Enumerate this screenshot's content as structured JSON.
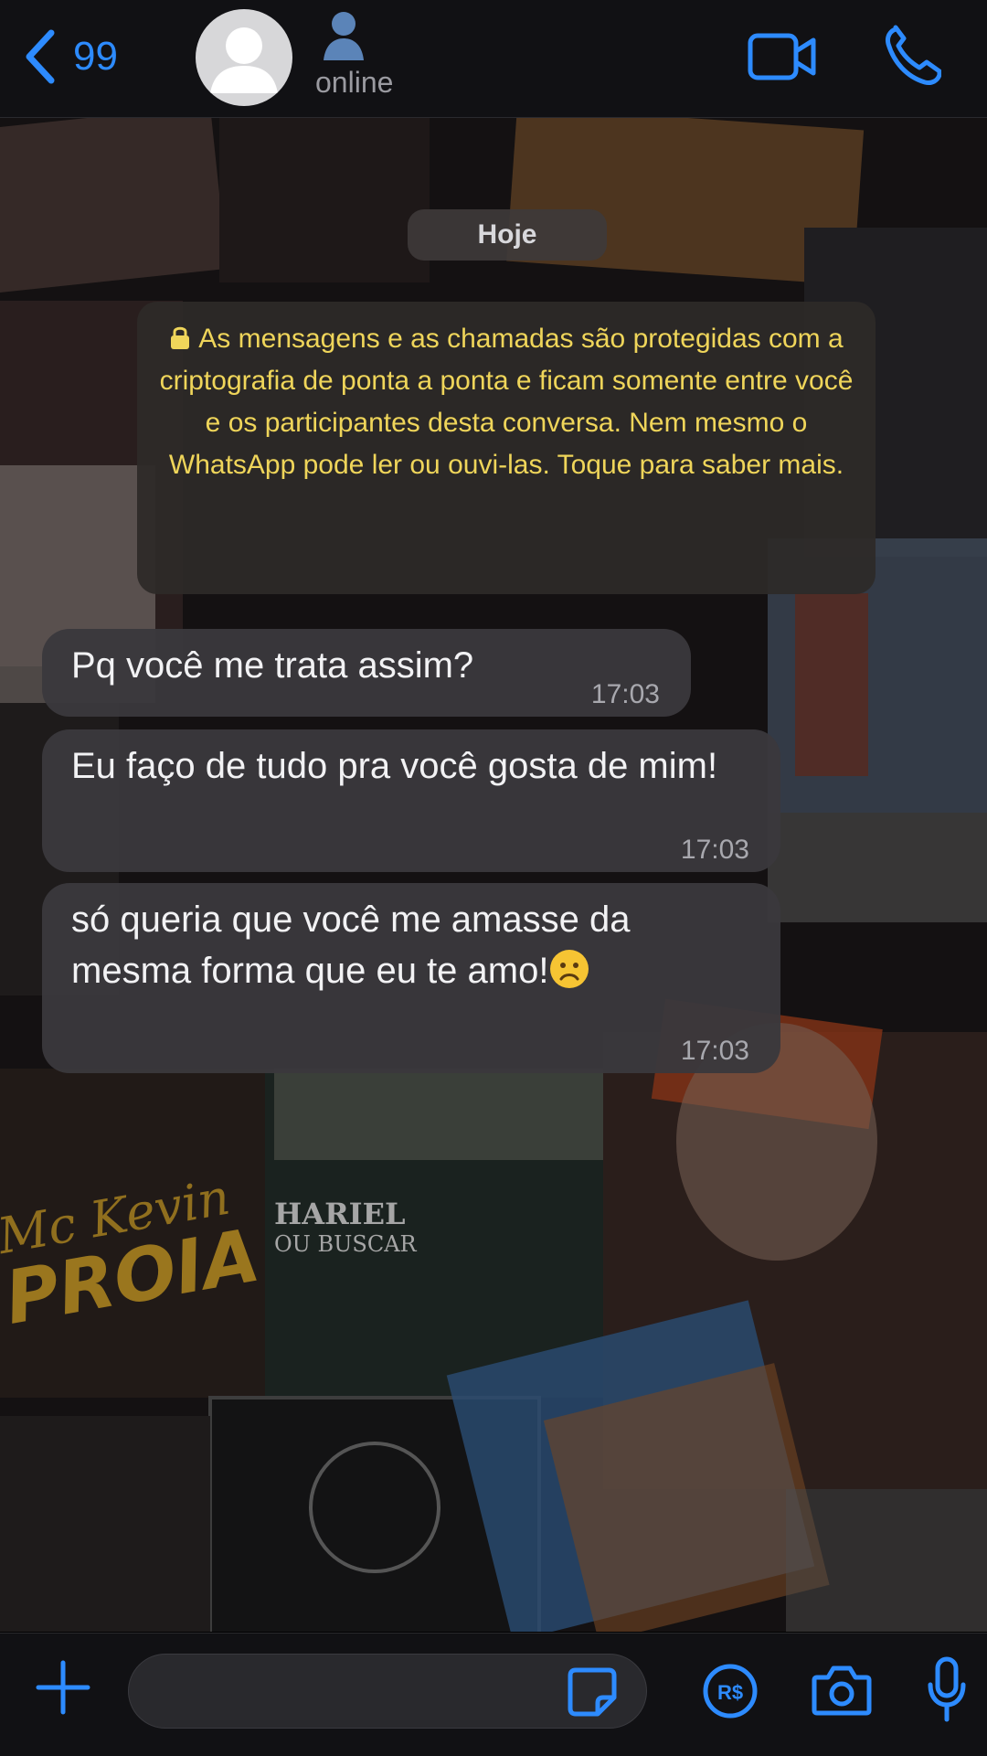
{
  "header": {
    "back_count": "99",
    "status": "online"
  },
  "chat": {
    "date_label": "Hoje",
    "encryption_notice": "As mensagens e as chamadas são protegidas com a criptografia de ponta a ponta e ficam somente entre você e os participantes desta conversa. Nem mesmo o WhatsApp pode ler ou ouvi-las. Toque para saber mais.",
    "messages": [
      {
        "text": "Pq você me trata assim?",
        "time": "17:03"
      },
      {
        "text": "Eu faço de tudo pra você gosta de mim!",
        "time": "17:03"
      },
      {
        "text": "só queria que você me amasse da mesma forma que eu te amo!",
        "time": "17:03",
        "emoji": "sad-face"
      }
    ]
  },
  "wallpaper_text": [
    "Mc Kevin",
    "PROIA",
    "HARIEL",
    "OU BUSCAR"
  ],
  "colors": {
    "accent": "#2d8bff",
    "notice_text": "#efd55a",
    "bubble": "#3a383c"
  },
  "icons": [
    "chevron-left-icon",
    "avatar-icon",
    "contact-icon",
    "video-call-icon",
    "phone-icon",
    "plus-icon",
    "sticker-icon",
    "payment-icon",
    "camera-icon",
    "mic-icon"
  ]
}
